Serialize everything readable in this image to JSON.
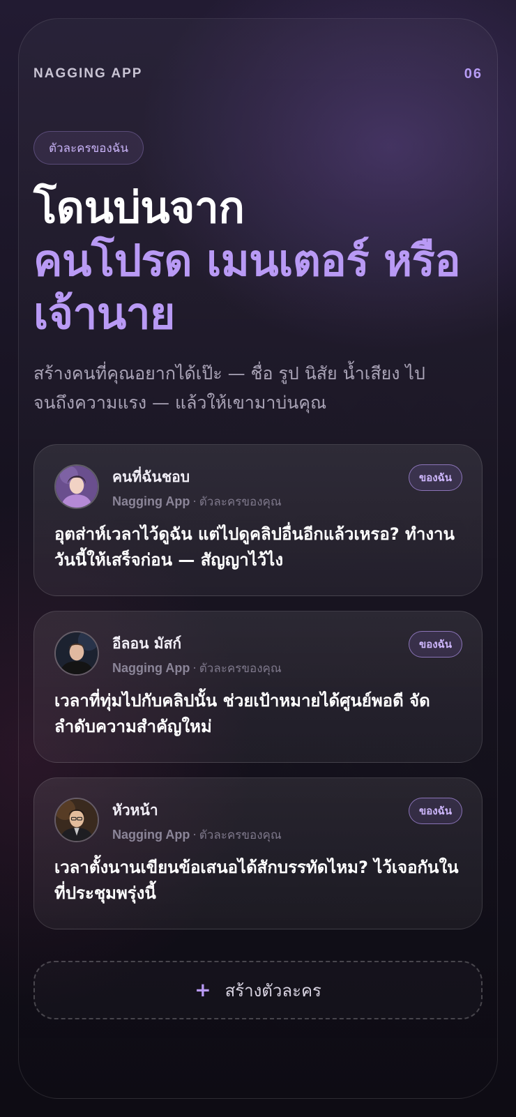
{
  "app": {
    "name": "NAGGING APP",
    "page_number": "06"
  },
  "tag": "ตัวละครของฉัน",
  "headline": {
    "line1": "โดนบ่นจาก",
    "line2": "คนโปรด เมนเตอร์ หรือ เจ้านาย"
  },
  "subtitle": "สร้างคนที่คุณอยากได้เป๊ะ — ชื่อ รูป นิสัย น้ำเสียง ไป จนถึงความแรง — แล้วให้เขามาบ่นคุณ",
  "cards": [
    {
      "name": "คนที่ฉันชอบ",
      "brand": "Nagging App",
      "meta": "ตัวละครของคุณ",
      "badge": "ของฉัน",
      "message": "อุตส่าห์เวลาไว้ดูฉัน แต่ไปดูคลิปอื่นอีกแล้วเหรอ? ทำงานวันนี้ให้เสร็จก่อน — สัญญาไว้ไง"
    },
    {
      "name": "อีลอน มัสก์",
      "brand": "Nagging App",
      "meta": "ตัวละครของคุณ",
      "badge": "ของฉัน",
      "message": "เวลาที่ทุ่มไปกับคลิปนั้น ช่วยเป้าหมายได้ศูนย์พอดี จัดลำดับความสำคัญใหม่"
    },
    {
      "name": "หัวหน้า",
      "brand": "Nagging App",
      "meta": "ตัวละครของคุณ",
      "badge": "ของฉัน",
      "message": "เวลาตั้งนานเขียนข้อเสนอได้สักบรรทัดไหม? ไว้เจอกันในที่ประชุมพรุ่งนี้"
    }
  ],
  "create_button": {
    "icon": "plus-icon",
    "label": "สร้างตัวละคร"
  },
  "colors": {
    "accent": "#b99af5",
    "background": "#100e17",
    "card_text": "#ffffff"
  }
}
